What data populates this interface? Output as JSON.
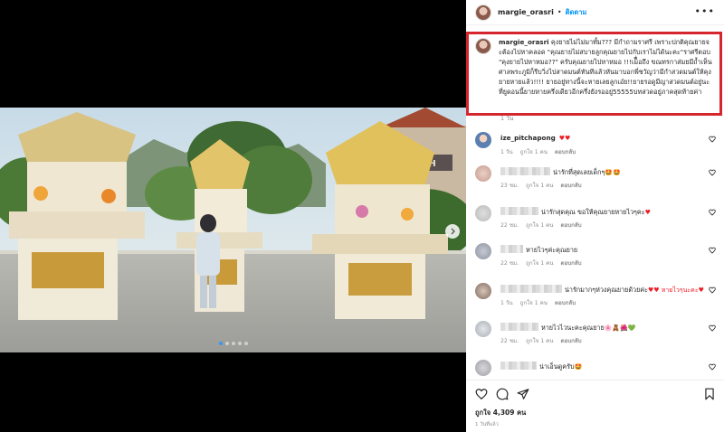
{
  "post": {
    "owner": "margie_orasri",
    "separator": "•",
    "follow_label": "ติดตาม",
    "more_label": "•••",
    "carousel": {
      "total_slides": 5,
      "active_index": 0
    }
  },
  "caption": {
    "username": "margie_orasri",
    "text": "คุงยายไม่ไม่มาทั้ม??? มีกำถามราศรี เพราะปกติคุณยายจะต้องไปหาคลอด \"คุณยายไม่สบายลูกคุณยายไปกับเราไม่ได้นะคะ\"ราศรีตอบ \"คุงยายไปหาหมอ??\" ครับคุณยายไปหาหมอ !!!เม็ื่อถึง ขณทรกาส่มยมีถ้ำเห็นศาลพระภูมิก็รีบวิ่งไปสาดมนต์ทันทีแล้วหันมาบอกพี่ชวัญว่ามีกำสวดมนต์ให้คุงยายหายแล้ว!!!! ยายอยู่ทางนี้จะหายเลยลูกเอ๋ย!!ยายรอดูมีญาสวดมนต์อยู่นะที่ยูดอนนี้ยายหายครึ่งเดียวอีกครึ่งยังรออยู่55555บทสวดอยู่ภาคสุดท้ายค่า",
    "time": "1 วัน"
  },
  "comments": [
    {
      "kind": "named",
      "user": "ize_pitchapong",
      "text": "",
      "emoji": "♥♥",
      "meta": [
        "1 วัน",
        "ถูกใจ 1 คน",
        "ตอบกลับ"
      ]
    },
    {
      "kind": "blurred",
      "text": "น่ารักที่สุดเลยเด็กๆ",
      "emoji": "🤩🤩",
      "meta": [
        "23 ชม.",
        "ถูกใจ 1 คน",
        "ตอบกลับ"
      ]
    },
    {
      "kind": "blurred",
      "text": "น่ารักสุดคุณ ขอให้คุณยายหายไวๆคะ",
      "emoji": "♥",
      "meta": [
        "22 ชม.",
        "ถูกใจ 1 คน",
        "ตอบกลับ"
      ]
    },
    {
      "kind": "blurred",
      "text": "หายไวๆค่ะคุณยาย",
      "emoji": "",
      "meta": [
        "22 ชม.",
        "ถูกใจ 1 คน",
        "ตอบกลับ"
      ]
    },
    {
      "kind": "blurred",
      "text": "น่ารักมากๆห่วงคุณยายด้วยค่ะ",
      "emoji": "♥♥ หายไวๆนะคะ♥",
      "meta": [
        "1 วัน",
        "ถูกใจ 1 คน",
        "ตอบกลับ"
      ]
    },
    {
      "kind": "blurred",
      "text": "หายไวไวนะคะคุณยาย",
      "emoji": "🌸🧸🌺💚",
      "meta": [
        "22 ชม.",
        "ถูกใจ 1 คน",
        "ตอบกลับ"
      ]
    },
    {
      "kind": "blurred",
      "text": "น่าเอ็นดูครับ",
      "emoji": "🤩",
      "meta": []
    }
  ],
  "actions": {
    "likes": "ถูกใจ 4,309 คน",
    "time": "1 วันที่แล้ว",
    "icons": [
      "heart-icon",
      "comment-icon",
      "share-icon",
      "bookmark-icon"
    ]
  },
  "colors": {
    "highlight_border": "#d6262d",
    "follow_blue": "#0095f6",
    "heart_red": "#ed1c24",
    "muted_text": "#8e8e8e"
  }
}
